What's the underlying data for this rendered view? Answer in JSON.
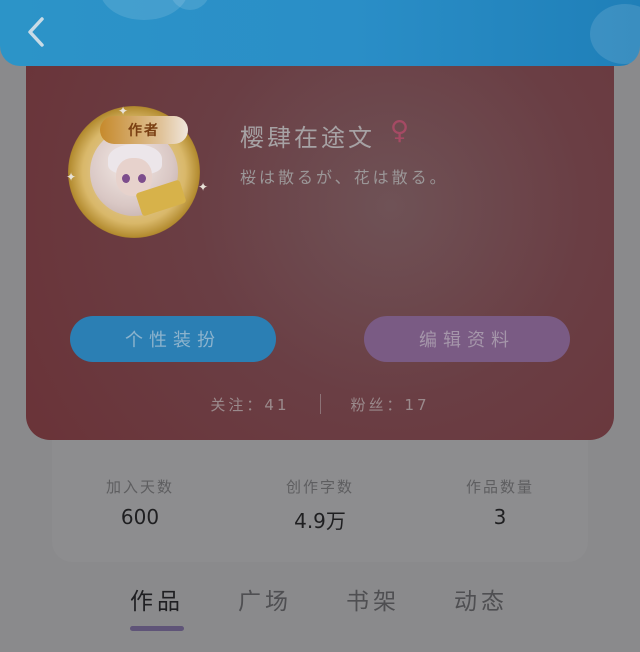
{
  "header": {
    "back_icon": "chevron-left-icon"
  },
  "profile": {
    "avatar_badge": "作者",
    "username": "樱肆在途文",
    "gender_icon": "female-icon",
    "gender_symbol": "♀",
    "signature": "桜は散るが、花は散る。"
  },
  "actions": {
    "dress_label": "个性装扮",
    "edit_label": "编辑资料"
  },
  "follow": {
    "following_text": "关注：41",
    "fans_text": "粉丝：17"
  },
  "stats": [
    {
      "label": "加入天数",
      "value": "600"
    },
    {
      "label": "创作字数",
      "value": "4.9万"
    },
    {
      "label": "作品数量",
      "value": "3"
    }
  ],
  "tabs": [
    {
      "label": "作品",
      "active": true
    },
    {
      "label": "广场",
      "active": false
    },
    {
      "label": "书架",
      "active": false
    },
    {
      "label": "动态",
      "active": false
    }
  ],
  "colors": {
    "header": "#2a8ec7",
    "card": "#6a3e44",
    "dress_button": "#2b7fb4",
    "edit_button": "#7a5b84",
    "tab_indicator": "#5f5478"
  }
}
